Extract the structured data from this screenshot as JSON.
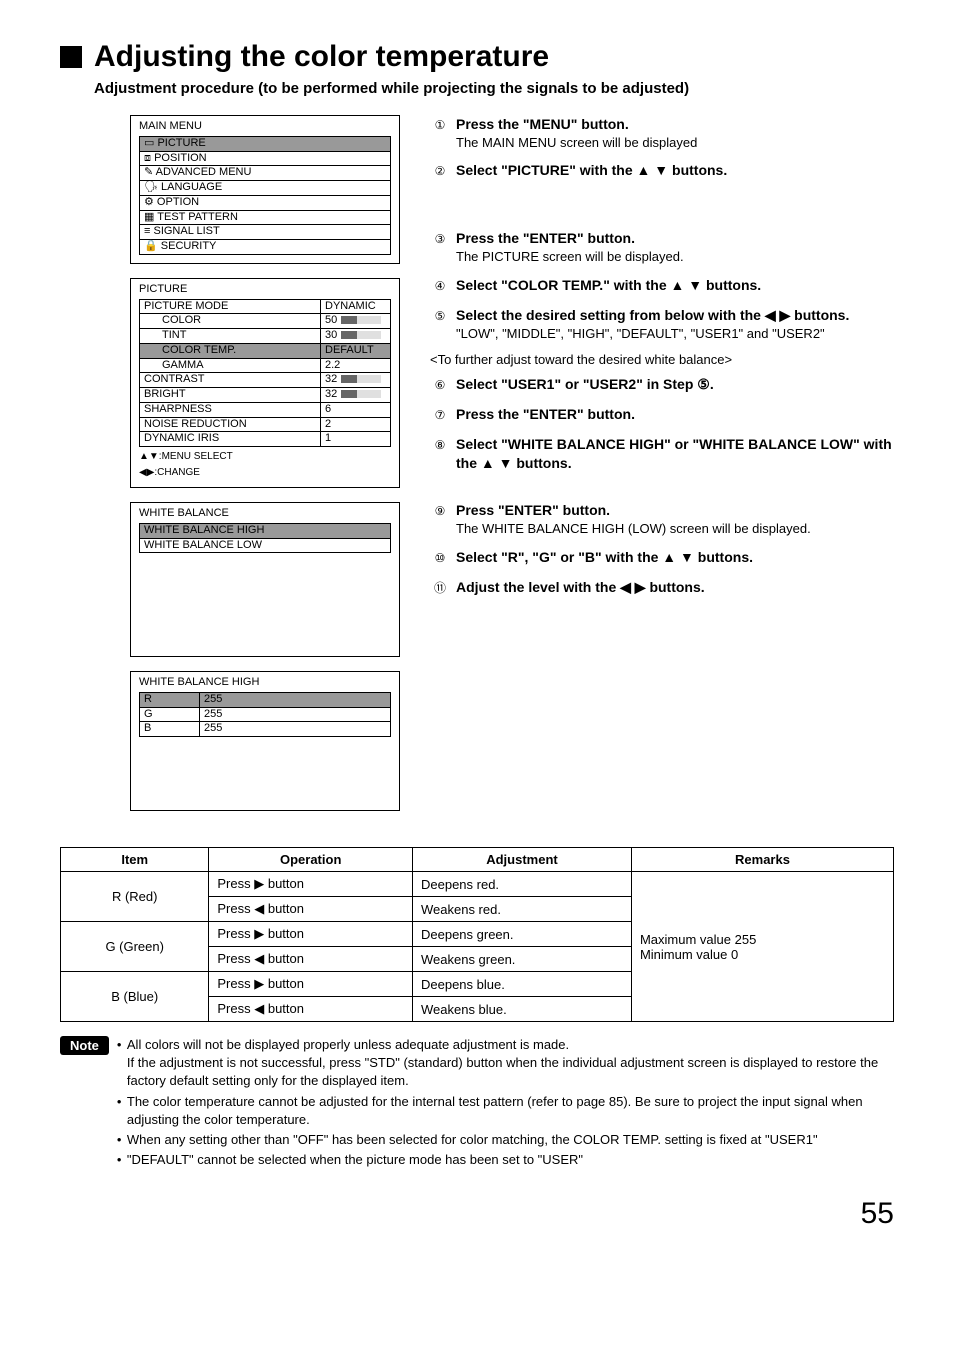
{
  "page": {
    "number": "55"
  },
  "heading": "Adjusting the color temperature",
  "subheading": "Adjustment procedure (to be performed while projecting the signals to be adjusted)",
  "osd_main": {
    "title": "MAIN MENU",
    "items": [
      {
        "icon": "▭",
        "label": "PICTURE",
        "selected": true
      },
      {
        "icon": "⧈",
        "label": "POSITION"
      },
      {
        "icon": "✎",
        "label": "ADVANCED MENU"
      },
      {
        "icon": "🗣",
        "label": "LANGUAGE"
      },
      {
        "icon": "⚙",
        "label": "OPTION"
      },
      {
        "icon": "▦",
        "label": "TEST PATTERN"
      },
      {
        "icon": "≡",
        "label": "SIGNAL LIST"
      },
      {
        "icon": "🔒",
        "label": "SECURITY"
      }
    ]
  },
  "osd_picture": {
    "title": "PICTURE",
    "hint1": "▲▼:MENU SELECT",
    "hint2": "◀▶:CHANGE",
    "rows": [
      {
        "label": "PICTURE MODE",
        "value": "DYNAMIC",
        "bar": false
      },
      {
        "label": "COLOR",
        "value": "50",
        "bar": true,
        "indent": true
      },
      {
        "label": "TINT",
        "value": "30",
        "bar": true,
        "indent": true
      },
      {
        "label": "COLOR TEMP.",
        "value": "DEFAULT",
        "bar": false,
        "indent": true,
        "selected": true
      },
      {
        "label": "GAMMA",
        "value": "2.2",
        "bar": false,
        "indent": true
      },
      {
        "label": "CONTRAST",
        "value": "32",
        "bar": true
      },
      {
        "label": "BRIGHT",
        "value": "32",
        "bar": true
      },
      {
        "label": "SHARPNESS",
        "value": "6",
        "bar": false
      },
      {
        "label": "NOISE REDUCTION",
        "value": "2",
        "bar": false
      },
      {
        "label": "DYNAMIC IRIS",
        "value": "1",
        "bar": false
      }
    ]
  },
  "osd_wb": {
    "title": "WHITE BALANCE",
    "rows": [
      {
        "label": "WHITE BALANCE HIGH",
        "selected": true
      },
      {
        "label": "WHITE BALANCE LOW"
      }
    ]
  },
  "osd_wbhigh": {
    "title": "WHITE BALANCE HIGH",
    "rows": [
      {
        "label": "R",
        "value": "255",
        "selected": true
      },
      {
        "label": "G",
        "value": "255"
      },
      {
        "label": "B",
        "value": "255"
      }
    ]
  },
  "steps": {
    "s1t": "Press the \"MENU\" button.",
    "s1s": "The MAIN MENU screen will be displayed",
    "s2t": "Select \"PICTURE\" with the  ▲ ▼ buttons.",
    "s3t": "Press the \"ENTER\" button.",
    "s3s": "The PICTURE screen will be displayed.",
    "s4t": "Select \"COLOR TEMP.\" with the  ▲ ▼ buttons.",
    "s5t": "Select the desired setting from below with the  ◀  ▶  buttons.",
    "s5s": "\"LOW\", \"MIDDLE\", \"HIGH\", \"DEFAULT\", \"USER1\" and \"USER2\"",
    "mid": "<To further adjust toward the desired white balance>",
    "s6t": "Select \"USER1\" or \"USER2\" in Step ⑤.",
    "s7t": "Press the \"ENTER\" button.",
    "s8t": "Select \"WHITE BALANCE HIGH\" or \"WHITE BALANCE LOW\" with the  ▲ ▼ buttons.",
    "s9t": "Press \"ENTER\" button.",
    "s9s": "The WHITE BALANCE HIGH (LOW) screen will be displayed.",
    "s10t": "Select \"R\", \"G\" or \"B\" with the  ▲ ▼ buttons.",
    "s11t": "Adjust the level with the  ◀  ▶  buttons."
  },
  "table": {
    "headers": {
      "item": "Item",
      "op": "Operation",
      "adj": "Adjustment",
      "rem": "Remarks"
    },
    "remarks": "Maximum value 255\nMinimum value 0",
    "rows": [
      {
        "item": "R (Red)",
        "op1": "Press  ▶  button",
        "adj1": "Deepens red.",
        "op2": "Press  ◀  button",
        "adj2": "Weakens red."
      },
      {
        "item": "G (Green)",
        "op1": "Press  ▶  button",
        "adj1": "Deepens green.",
        "op2": "Press  ◀  button",
        "adj2": "Weakens green."
      },
      {
        "item": "B (Blue)",
        "op1": "Press  ▶  button",
        "adj1": "Deepens blue.",
        "op2": "Press  ◀  button",
        "adj2": "Weakens blue."
      }
    ]
  },
  "notes": {
    "label": "Note",
    "items": [
      "All colors will not be displayed properly unless adequate adjustment is made.\nIf the adjustment is not successful, press \"STD\" (standard) button when the individual adjustment screen is displayed to restore the factory default setting only for the displayed item.",
      "The color temperature cannot be adjusted for the internal test pattern (refer to page 85).  Be sure to project the input signal when adjusting the color temperature.",
      "When any setting other than \"OFF\" has been selected for color matching, the COLOR TEMP. setting is fixed at \"USER1\"",
      "\"DEFAULT\" cannot be selected when the picture mode has been set to \"USER\""
    ]
  }
}
